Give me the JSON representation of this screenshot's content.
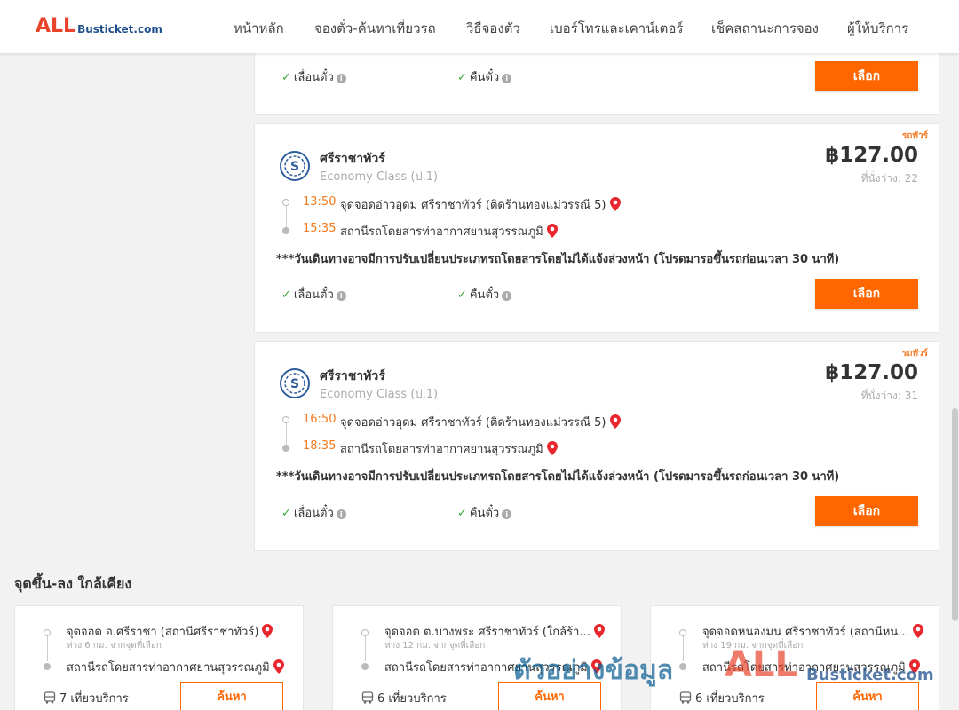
{
  "brand": {
    "logo_all": "ALL",
    "logo_rest": "Busticket.com"
  },
  "nav": [
    "หน้าหลัก",
    "จองตั๋ว-ค้นหาเที่ยวรถ",
    "วิธีจองตั๋ว",
    "เบอร์โทรและเคาน์เตอร์",
    "เช็คสถานะการจอง",
    "ผู้ให้บริการ"
  ],
  "partial_card": {
    "feature1": "เลื่อนตั๋ว",
    "feature2": "คืนตั๋ว",
    "select_label": "เลือก"
  },
  "trips": [
    {
      "tag": "รถทัวร์",
      "operator": "ศรีราชาทัวร์",
      "bus_class": "Economy Class (ป.1)",
      "price": "฿127.00",
      "seats": "ที่นั่งว่าง: 22",
      "depart_time": "13:50",
      "depart_stop": "จุดจอดอ่าวอุดม ศรีราชาทัวร์ (ติดร้านทองแม่วรรณี 5)",
      "arrive_time": "15:35",
      "arrive_stop": "สถานีรถโดยสารท่าอากาศยานสุวรรณภูมิ",
      "note": "***วันเดินทางอาจมีการปรับเปลี่ยนประเภทรถโดยสารโดยไม่ได้แจ้งล่วงหน้า (โปรดมารอขึ้นรถก่อนเวลา 30 นาที)",
      "feature1": "เลื่อนตั๋ว",
      "feature2": "คืนตั๋ว",
      "select_label": "เลือก"
    },
    {
      "tag": "รถทัวร์",
      "operator": "ศรีราชาทัวร์",
      "bus_class": "Economy Class (ป.1)",
      "price": "฿127.00",
      "seats": "ที่นั่งว่าง: 31",
      "depart_time": "16:50",
      "depart_stop": "จุดจอดอ่าวอุดม ศรีราชาทัวร์ (ติดร้านทองแม่วรรณี 5)",
      "arrive_time": "18:35",
      "arrive_stop": "สถานีรถโดยสารท่าอากาศยานสุวรรณภูมิ",
      "note": "***วันเดินทางอาจมีการปรับเปลี่ยนประเภทรถโดยสารโดยไม่ได้แจ้งล่วงหน้า (โปรดมารอขึ้นรถก่อนเวลา 30 นาที)",
      "feature1": "เลื่อนตั๋ว",
      "feature2": "คืนตั๋ว",
      "select_label": "เลือก"
    }
  ],
  "nearby": {
    "title": "จุดขึ้น-ลง ใกล้เคียง",
    "items": [
      {
        "from": "จุดจอด อ.ศรีราชา (สถานีศรีราชาทัวร์)",
        "distance": "ห่าง 6 กม. จากจุดที่เลือก",
        "to": "สถานีรถโดยสารท่าอากาศยานสุวรรณภูมิ",
        "trips": "7 เที่ยวบริการ",
        "search_label": "ค้นหา"
      },
      {
        "from": "จุดจอด ต.บางพระ ศรีราชาทัวร์ (ใกล้ร้า...",
        "distance": "ห่าง 12 กม. จากจุดที่เลือก",
        "to": "สถานีรถโดยสารท่าอากาศยานสุวรรณภูมิ",
        "trips": "6 เที่ยวบริการ",
        "search_label": "ค้นหา"
      },
      {
        "from": "จุดจอดหนองมน ศรีราชาทัวร์ (สถานีหน...",
        "distance": "ห่าง 19 กม. จากจุดที่เลือก",
        "to": "สถานีรถโดยสารท่าอากาศยานสุวรรณภูมิ",
        "trips": "6 เที่ยวบริการ",
        "search_label": "ค้นหา"
      }
    ]
  },
  "watermark": {
    "text": "ตัวอย่างข้อมูล",
    "all": "ALL",
    "rest": "Busticket.com"
  },
  "colors": {
    "accent": "#ff6600",
    "time": "#f47a20",
    "check": "#3aa83a",
    "pin": "#e8262d",
    "brand_red": "#e8432b",
    "brand_blue": "#1e4f8c"
  },
  "icons": [
    "check-icon",
    "info-icon",
    "map-pin-icon",
    "bus-icon",
    "operator-logo-icon"
  ]
}
